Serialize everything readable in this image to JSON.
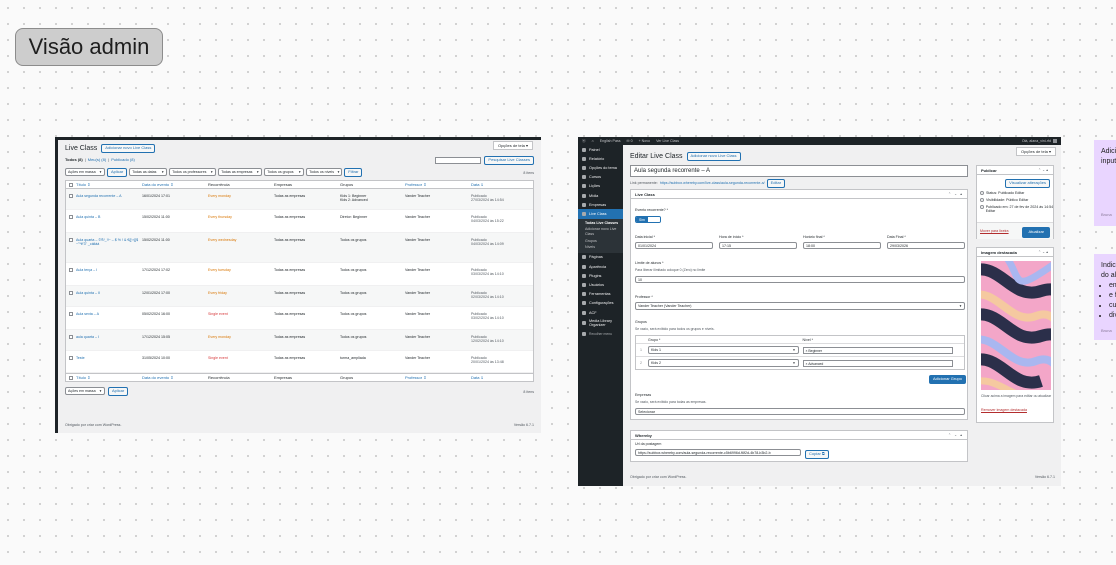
{
  "board": {
    "title": "Visão admin"
  },
  "list_screen": {
    "screen_options": "Opções de tela ▾",
    "title": "Live Class",
    "add_new": "Adicionar novo Live Class",
    "views": {
      "all": "Todos (8)",
      "sep1": "|",
      "mine": "Meu(s) (8)",
      "sep2": "|",
      "published": "Publicado (8)"
    },
    "search_button": "Pesquisar Live Classes",
    "bulk_action": "Ações em massa",
    "apply": "Aplicar",
    "filters": [
      "Todas as datas",
      "Todos os professores",
      "Todas as empresas",
      "Todos os grupos",
      "Todos os níveis"
    ],
    "filter_button": "Filtrar",
    "items_count": "8 itens",
    "columns": {
      "title": "Título ⇕",
      "event_date": "Data do evento ⇕",
      "recurrence": "Recorrência",
      "companies": "Empresas",
      "groups": "Grupos",
      "teacher": "Professor ⇕",
      "date": "Data ⇓"
    },
    "rows": [
      {
        "title": "Aula segunda recorrente – A",
        "event_date": "16/01/2024 17:01",
        "recurrence": "Every monday",
        "rec_color": "orange",
        "companies": "Todas as empresas",
        "groups": [
          "Kids 1: Beginner",
          "Kids 2: Advanced"
        ],
        "teacher": "Vander Teacher",
        "pub_status": "Publicado",
        "pub_date": "27/03/2024 às 14:54"
      },
      {
        "title": "Aula quinta – B",
        "event_date": "15/02/2024 11:00",
        "recurrence": "Every thursday",
        "rec_color": "orange",
        "companies": "Todas as empresas",
        "groups": [
          "Diretor: Beginner"
        ],
        "teacher": "Vander Teacher",
        "pub_status": "Publicado",
        "pub_date": "04/03/2024 às 15:22"
      },
      {
        "title": "Aula quarta – ©®/_!!~ – $ % ! & €{[‹›}]$ ~°*¥'3\" _cáliáá",
        "event_date": "15/02/2024 11:00",
        "recurrence": "Every wednesday",
        "rec_color": "orange",
        "companies": "Todas as empresas",
        "groups": [
          "Todos os grupos"
        ],
        "teacher": "Vander Teacher",
        "pub_status": "Publicado",
        "pub_date": "04/03/2024 às 14:09"
      },
      {
        "title": "Aula terça – I",
        "event_date": "17/12/2024 17:02",
        "recurrence": "Every tuesday",
        "rec_color": "orange",
        "companies": "Todas as empresas",
        "groups": [
          "Todos os grupos"
        ],
        "teacher": "Vander Teacher",
        "pub_status": "Publicado",
        "pub_date": "03/03/2024 às 14:10"
      },
      {
        "title": "Aula quinta – II",
        "event_date": "12/01/2024 17:00",
        "recurrence": "Every friday",
        "rec_color": "orange",
        "companies": "Todas as empresas",
        "groups": [
          "Todos os grupos"
        ],
        "teacher": "Vander Teacher",
        "pub_status": "Publicado",
        "pub_date": "02/03/2024 às 14:10"
      },
      {
        "title": "Aula sexta – A",
        "event_date": "05/02/2024 16:00",
        "recurrence": "Single event",
        "rec_color": "red",
        "companies": "Todas as empresas",
        "groups": [
          "Todos os grupos"
        ],
        "teacher": "Vander Teacher",
        "pub_status": "Publicado",
        "pub_date": "03/02/2024 às 14:10"
      },
      {
        "title": "aula quarta – I",
        "event_date": "17/12/2024 15:05",
        "recurrence": "Every monday",
        "rec_color": "orange",
        "companies": "Todas as empresas",
        "groups": [
          "Todos os grupos"
        ],
        "teacher": "Vander Teacher",
        "pub_status": "Publicado",
        "pub_date": "12/02/2024 às 14:10"
      },
      {
        "title": "Teste",
        "event_date": "31/05/2024 10:00",
        "recurrence": "Single event",
        "rec_color": "red",
        "companies": "Todas as empresas",
        "groups": [
          "turma_ampliada"
        ],
        "teacher": "Vander Teacher",
        "pub_status": "Publicado",
        "pub_date": "20/01/2024 às 13:48"
      }
    ],
    "footer_thanks": "Obrigado por criar com WordPress.",
    "version": "Versão 6.7.1"
  },
  "edit_screen": {
    "adminbar": {
      "site": "English Pass",
      "comments": "0",
      "new": "+ Novo",
      "view": "Ver Live Class",
      "user": "Olá, alana_vini-rfd"
    },
    "menu": [
      "Painel",
      "Relatório",
      "Opções do tema",
      "Cursos",
      "Lições",
      "Mídia",
      "Empresas",
      "Live Class",
      "Páginas",
      "Aparência",
      "Plugins",
      "Usuários",
      "Ferramentas",
      "Configurações",
      "ACF",
      "Media Library Organizer",
      "Recolher menu"
    ],
    "submenu": [
      "Todas Live Classes",
      "Adicionar novo Live Class",
      "Grupos",
      "Níveis"
    ],
    "title": "Editar Live Class",
    "add_new": "Adicionar novo Live Class",
    "screen_options": "Opções de tela ▾",
    "post_title": "Aula segunda recorrente – A",
    "permalink_label": "Link permanente:",
    "permalink_url": "https://subbox.whereby.com/live-class/aula-segunda-recorrente-a/",
    "permalink_edit": "Editar",
    "live_class_box": {
      "title": "Live Class",
      "recurring_label": "Evento recorrente? *",
      "toggle_on": "Sim",
      "start_date_label": "Data inicial *",
      "start_date": "01/01/2024",
      "start_time_label": "Hora de início *",
      "start_time": "17:15",
      "end_time_label": "Horário final *",
      "end_time": "18:00",
      "end_date_label": "Data Final *",
      "end_date": "29/03/2026",
      "limit_label": "Limite de alunos *",
      "limit_desc": "Para liberar ilimitado coloque 0 (Zero) no limite",
      "limit_value": "10",
      "teacher_label": "Professor *",
      "teacher_value": "Vander Teacher (Vander Teacher)",
      "groups_label": "Grupos",
      "groups_desc": "Se vazio, será exibido para todos os grupos e níveis.",
      "group_col": "Grupo *",
      "level_col": "Nível *",
      "groups_rows": [
        {
          "num": "1",
          "group": "Kids 1",
          "level": "× Beginner"
        },
        {
          "num": "2",
          "group": "Kids 2",
          "level": "× Advanced"
        }
      ],
      "add_group": "Adicionar Grupo",
      "companies_label": "Empresas",
      "companies_desc": "Se vazio, será exibido para todas as empresas.",
      "companies_value": "Selecionar"
    },
    "whereby_box": {
      "title": "Whereby",
      "url_label": "Url da postagem",
      "url_value": "https://subbox.whereby.com/aula-segunda-recorrente-c5b6996d-f6f2d-4b78-b3b2-b",
      "copy": "Copiar"
    },
    "publish_box": {
      "title": "Publicar",
      "preview": "Visualizar alterações",
      "status": "Status: Publicado Editar",
      "visibility": "Visibilidade: Público Editar",
      "published_on": "Publicado em: 27 de fev de 2024 às 14:54 Editar",
      "trash": "Mover para lixeira",
      "update": "Atualizar"
    },
    "featured_box": {
      "title": "Imagem destacada",
      "hint": "Clicar acima a imagem para editar ou atualizar",
      "remove": "Remover imagem destacada"
    },
    "footer_thanks": "Obrigado por criar com WordPress.",
    "version": "Versão 6.7.1"
  },
  "notes": [
    {
      "lines": [
        "Adici",
        "input"
      ],
      "meta": "Bruna"
    },
    {
      "lines": [
        "Indica",
        "do alu"
      ],
      "bullets": [
        "em",
        "e fi",
        "cur",
        "div"
      ],
      "meta": "Bruna"
    }
  ]
}
